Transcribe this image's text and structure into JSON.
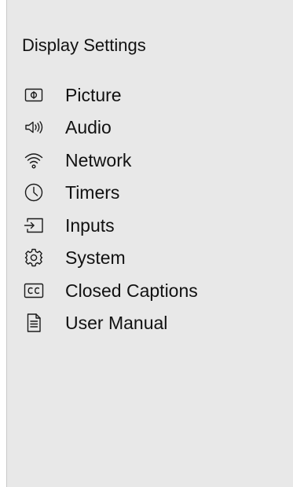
{
  "panel": {
    "title": "Display Settings",
    "items": [
      {
        "icon": "picture-icon",
        "label": "Picture"
      },
      {
        "icon": "audio-icon",
        "label": "Audio"
      },
      {
        "icon": "wifi-icon",
        "label": "Network"
      },
      {
        "icon": "clock-icon",
        "label": "Timers"
      },
      {
        "icon": "input-icon",
        "label": "Inputs"
      },
      {
        "icon": "gear-icon",
        "label": "System"
      },
      {
        "icon": "closed-captions-icon",
        "label": "Closed Captions"
      },
      {
        "icon": "document-icon",
        "label": "User Manual"
      }
    ]
  }
}
